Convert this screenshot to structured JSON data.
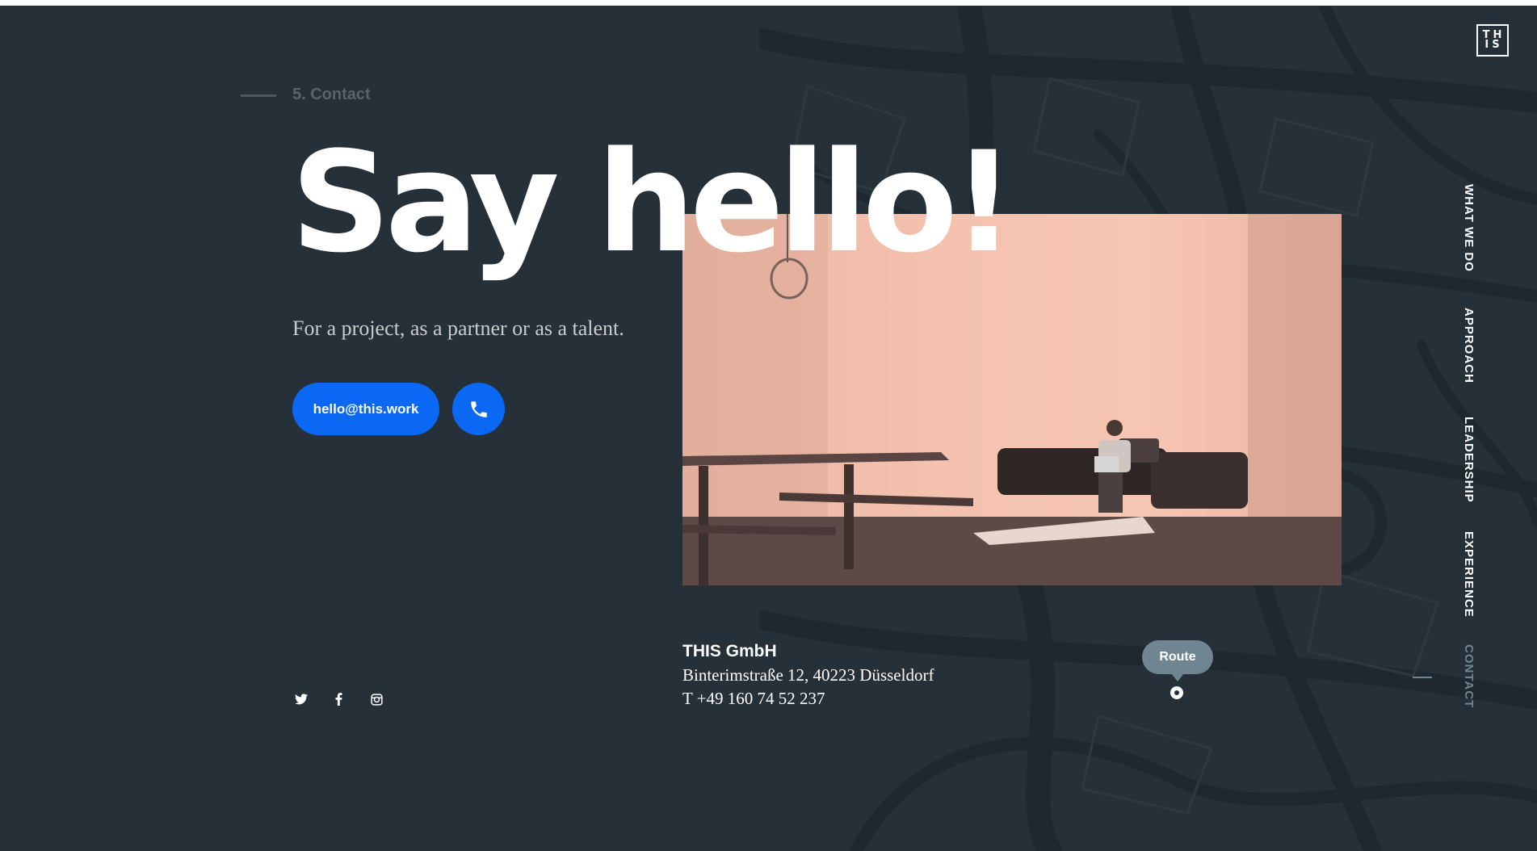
{
  "brand": {
    "logo_text": "TH\nIS"
  },
  "section": {
    "label": "5. Contact"
  },
  "hero": {
    "headline": "Say hello!",
    "subline": "For a project, as a partner or as a talent."
  },
  "actions": {
    "email_label": "hello@this.work",
    "phone_icon": "phone-icon"
  },
  "social": {
    "icons": [
      "twitter-icon",
      "facebook-icon",
      "instagram-icon"
    ]
  },
  "company": {
    "name": "THIS GmbH",
    "address": "Binterimstraße 12, 40223 Düsseldorf",
    "phone": "T +49 160 74 52 237"
  },
  "map": {
    "route_label": "Route"
  },
  "nav": {
    "items": [
      {
        "label": "WHAT WE DO",
        "active": false
      },
      {
        "label": "APPROACH",
        "active": false
      },
      {
        "label": "LEADERSHIP",
        "active": false
      },
      {
        "label": "EXPERIENCE",
        "active": false
      },
      {
        "label": "CONTACT",
        "active": true
      }
    ]
  },
  "colors": {
    "background": "#263039",
    "accent_blue": "#0a68f5",
    "muted_label": "#59636c",
    "route_bubble": "#6f8591",
    "photo_tint": "#f4c2ae"
  }
}
